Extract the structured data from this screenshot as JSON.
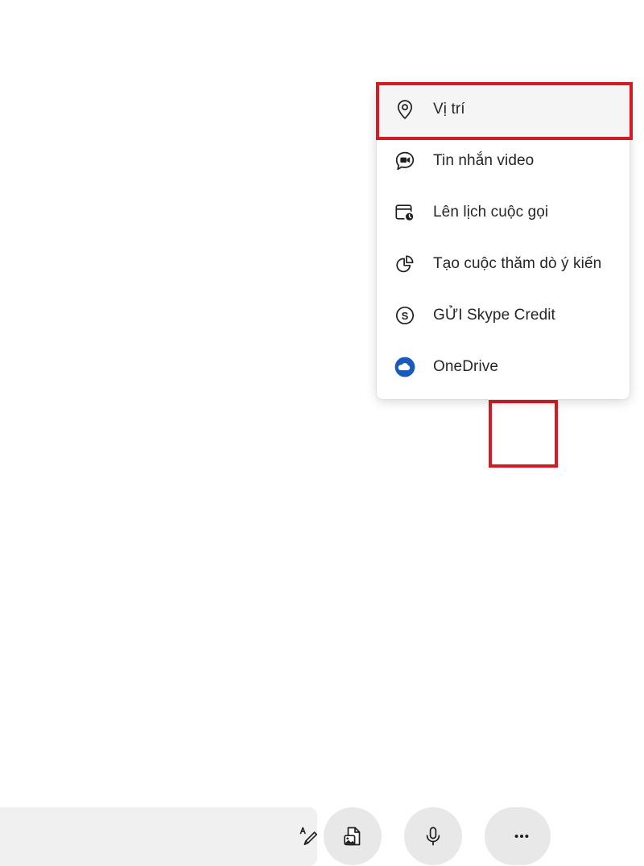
{
  "app": {
    "background_color": "#ffffff",
    "highlight_color": "#d71920"
  },
  "conversation": {
    "name": "conversation-area",
    "content": ""
  },
  "composer": {
    "input": {
      "value": "",
      "placeholder": ""
    },
    "actions": [
      {
        "id": "format",
        "icon": "text-format-icon",
        "label": ""
      },
      {
        "id": "file",
        "icon": "file-image-icon",
        "label": ""
      },
      {
        "id": "mic",
        "icon": "microphone-icon",
        "label": ""
      },
      {
        "id": "contact",
        "icon": "contact-card-icon",
        "label": ""
      },
      {
        "id": "more",
        "icon": "more-options-icon",
        "label": ""
      }
    ]
  },
  "flyout_menu": {
    "items": [
      {
        "label": "Vị trí",
        "icon": "location-pin-icon",
        "selected": true,
        "icon_color": "#1f1f1f"
      },
      {
        "label": "Tin nhắn video",
        "icon": "video-message-icon",
        "selected": false,
        "icon_color": "#1f1f1f"
      },
      {
        "label": "Lên lịch cuộc gọi",
        "icon": "schedule-call-icon",
        "selected": false,
        "icon_color": "#1f1f1f"
      },
      {
        "label": "Tạo cuộc thăm dò ý kiến",
        "icon": "poll-chart-icon",
        "selected": false,
        "icon_color": "#1f1f1f"
      },
      {
        "label": "GỬI Skype Credit",
        "icon": "skype-credit-icon",
        "selected": false,
        "icon_color": "#1f1f1f"
      },
      {
        "label": "OneDrive",
        "icon": "onedrive-icon",
        "selected": false,
        "icon_color": "#185abd"
      }
    ]
  },
  "highlights": [
    {
      "id": "hl-location",
      "target": "menu-item-vi-tri",
      "color": "#d71920"
    },
    {
      "id": "hl-more",
      "target": "more-options-button",
      "color": "#d71920"
    }
  ]
}
